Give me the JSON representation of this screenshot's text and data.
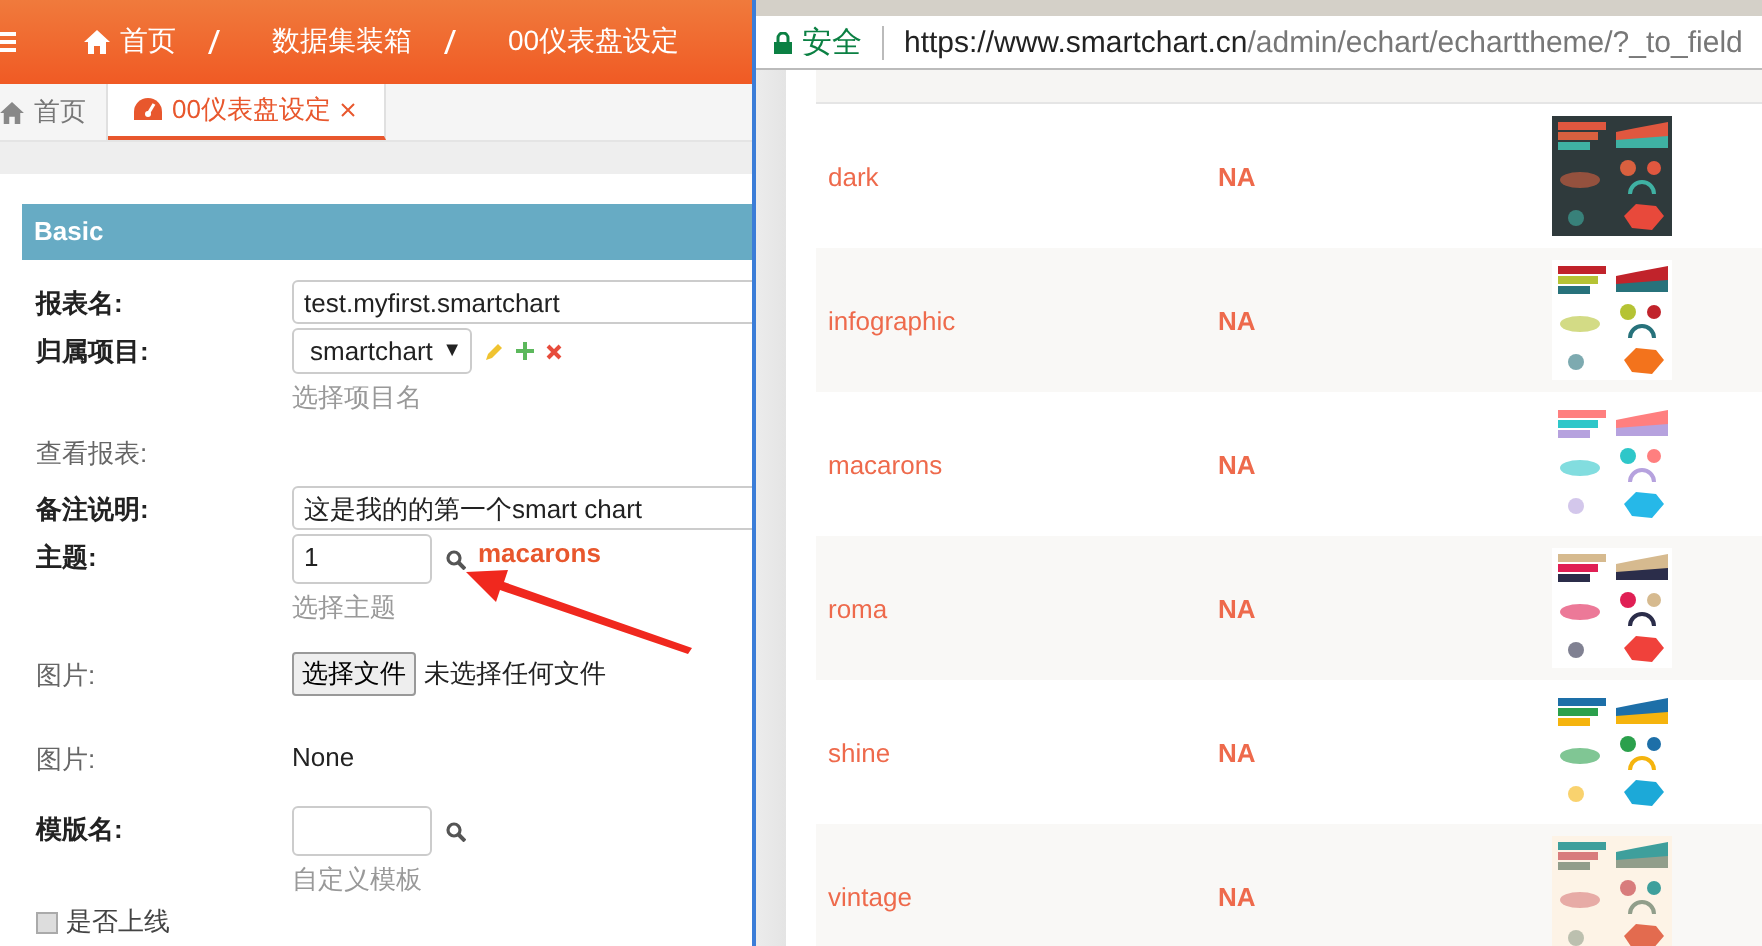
{
  "header": {
    "breadcrumbs": [
      "首页",
      "数据集装箱",
      "00仪表盘设定"
    ]
  },
  "tabs": [
    {
      "label": "首页",
      "selected": false,
      "closable": false
    },
    {
      "label": "00仪表盘设定",
      "selected": true,
      "closable": true
    }
  ],
  "panel": {
    "title": "Basic"
  },
  "form": [
    {
      "kind": "text",
      "label": "报表名:",
      "required": true,
      "value": "test.myfirst.smartchart"
    },
    {
      "kind": "select",
      "label": "归属项目:",
      "required": true,
      "value": "smartchart",
      "caret": "▼",
      "help": "选择项目名"
    },
    {
      "kind": "none",
      "label": "查看报表:",
      "required": false
    },
    {
      "kind": "text",
      "label": "备注说明:",
      "required": true,
      "value": "这是我的的第一个smart chart"
    },
    {
      "kind": "lookup",
      "label": "主题:",
      "required": true,
      "value": "1",
      "link": "macarons",
      "help": "选择主题"
    },
    {
      "kind": "file",
      "label": "图片:",
      "required": false,
      "button": "选择文件",
      "status": "未选择任何文件"
    },
    {
      "kind": "static",
      "label": "图片:",
      "required": false,
      "value": "None"
    },
    {
      "kind": "lookup",
      "label": "模版名:",
      "required": true,
      "help": "自定义模板"
    }
  ],
  "checkbox": {
    "label": "是否上线",
    "checked": false
  },
  "browser": {
    "secure_label": "安全",
    "url_host": "https://www.smartchart.cn",
    "url_path": "/admin/echart/echarttheme/?_to_field"
  },
  "themes": [
    {
      "name": "dark",
      "note": "NA"
    },
    {
      "name": "infographic",
      "note": "NA"
    },
    {
      "name": "macarons",
      "note": "NA"
    },
    {
      "name": "roma",
      "note": "NA"
    },
    {
      "name": "shine",
      "note": "NA"
    },
    {
      "name": "vintage",
      "note": "NA"
    }
  ]
}
